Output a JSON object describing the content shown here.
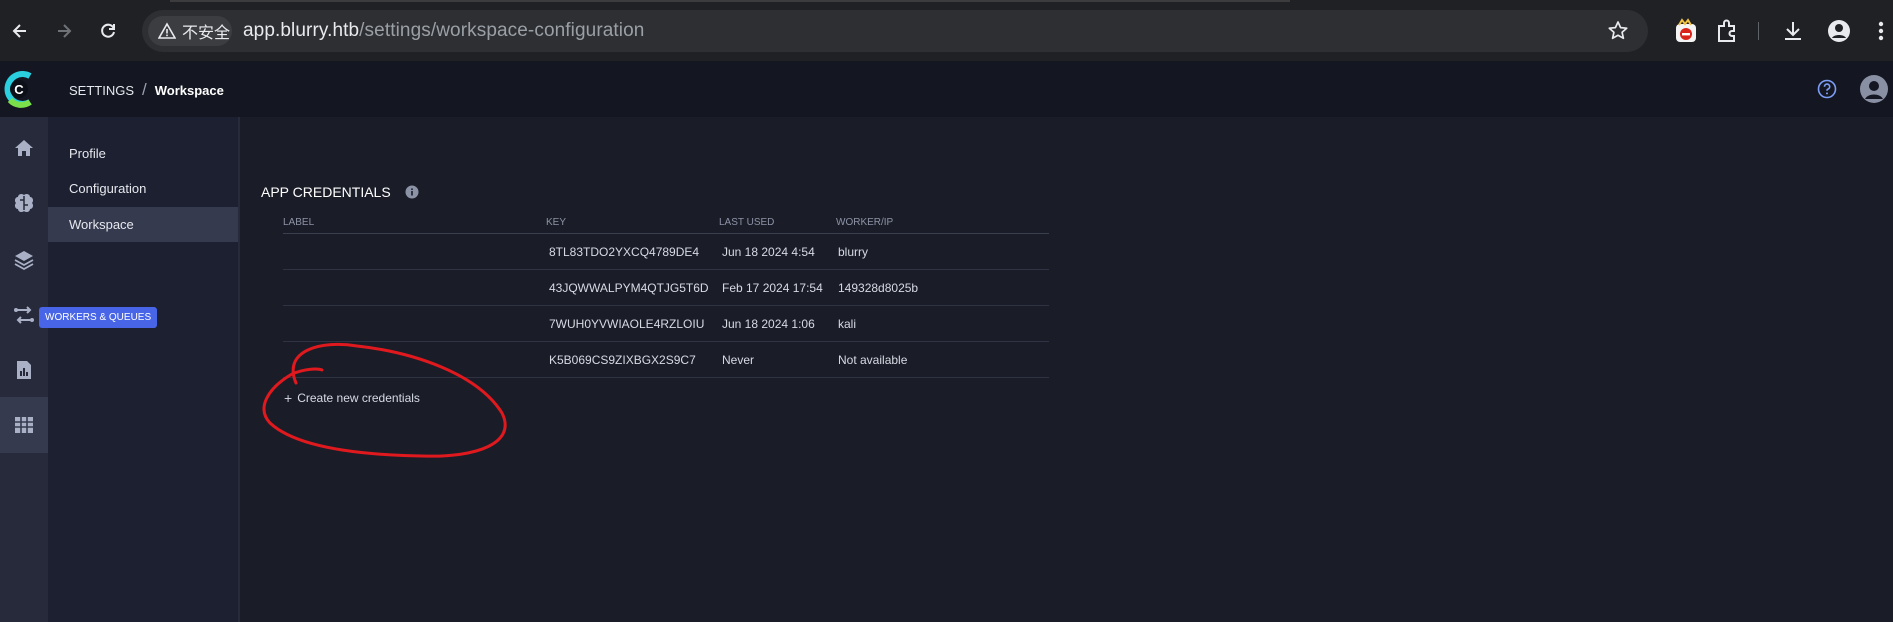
{
  "browser": {
    "security_label": "不安全",
    "url_host": "app.blurry.htb",
    "url_path": "/settings/workspace-configuration"
  },
  "header": {
    "breadcrumb_root": "SETTINGS",
    "breadcrumb_separator": "/",
    "breadcrumb_current": "Workspace"
  },
  "rail": {
    "tooltip": "WORKERS & QUEUES",
    "items": [
      "home-icon",
      "brain-icon",
      "layers-icon",
      "workers-queues-icon",
      "reports-icon",
      "settings-table-icon"
    ],
    "active_index": 5
  },
  "settings_menu": {
    "items": [
      {
        "label": "Profile"
      },
      {
        "label": "Configuration"
      },
      {
        "label": "Workspace",
        "active": true
      }
    ]
  },
  "credentials": {
    "title": "APP CREDENTIALS",
    "columns": [
      "LABEL",
      "KEY",
      "LAST USED",
      "WORKER/IP"
    ],
    "rows": [
      {
        "label": "",
        "key": "8TL83TDO2YXCQ4789DE4",
        "last_used": "Jun 18 2024 4:54",
        "worker_ip": "blurry"
      },
      {
        "label": "",
        "key": "43JQWWALPYM4QTJG5T6D",
        "last_used": "Feb 17 2024 17:54",
        "worker_ip": "149328d8025b"
      },
      {
        "label": "",
        "key": "7WUH0YVWIAOLE4RZLOIU",
        "last_used": "Jun 18 2024 1:06",
        "worker_ip": "kali"
      },
      {
        "label": "",
        "key": "K5B069CS9ZIXBGX2S9C7",
        "last_used": "Never",
        "worker_ip": "Not available"
      }
    ],
    "create_label": "Create new credentials"
  },
  "colors": {
    "accent": "#4865e8",
    "annotation": "#e0191e",
    "logo_cyan": "#2ad0e0",
    "logo_green": "#7be04a"
  }
}
